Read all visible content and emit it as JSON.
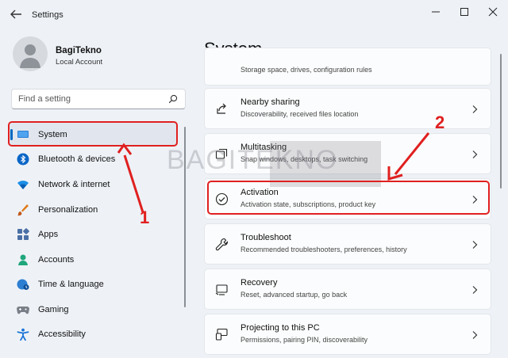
{
  "window": {
    "title": "Settings"
  },
  "profile": {
    "name": "BagiTekno",
    "account_type": "Local Account"
  },
  "search": {
    "placeholder": "Find a setting"
  },
  "sidebar": {
    "items": [
      {
        "label": "System",
        "icon": "monitor-icon",
        "selected": true
      },
      {
        "label": "Bluetooth & devices",
        "icon": "bluetooth-icon"
      },
      {
        "label": "Network & internet",
        "icon": "wifi-icon"
      },
      {
        "label": "Personalization",
        "icon": "brush-icon"
      },
      {
        "label": "Apps",
        "icon": "apps-icon"
      },
      {
        "label": "Accounts",
        "icon": "person-icon"
      },
      {
        "label": "Time & language",
        "icon": "globe-clock-icon"
      },
      {
        "label": "Gaming",
        "icon": "gamepad-icon"
      },
      {
        "label": "Accessibility",
        "icon": "accessibility-icon"
      }
    ]
  },
  "main": {
    "title": "System",
    "cards": [
      {
        "title": "",
        "subtitle": "Storage space, drives, configuration rules",
        "icon": "storage-icon"
      },
      {
        "title": "Nearby sharing",
        "subtitle": "Discoverability, received files location",
        "icon": "share-icon"
      },
      {
        "title": "Multitasking",
        "subtitle": "Snap windows, desktops, task switching",
        "icon": "multitasking-icon"
      },
      {
        "title": "Activation",
        "subtitle": "Activation state, subscriptions, product key",
        "icon": "check-circle-icon"
      },
      {
        "title": "Troubleshoot",
        "subtitle": "Recommended troubleshooters, preferences, history",
        "icon": "wrench-icon"
      },
      {
        "title": "Recovery",
        "subtitle": "Reset, advanced startup, go back",
        "icon": "recovery-icon"
      },
      {
        "title": "Projecting to this PC",
        "subtitle": "Permissions, pairing PIN, discoverability",
        "icon": "projector-icon"
      }
    ]
  },
  "annotations": {
    "step1": "1",
    "step2": "2",
    "watermark": "BAGITEKNO"
  },
  "colors": {
    "accent": "#0067c0",
    "annotation": "#e02020"
  }
}
